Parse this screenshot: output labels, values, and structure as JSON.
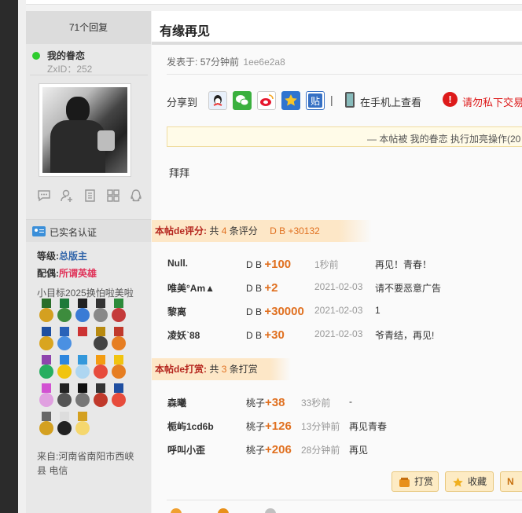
{
  "sidebar": {
    "reply_count": "71个回复",
    "username": "我的眷恋",
    "zxid": "ZxID：252",
    "realname": "已实名认证",
    "level_label": "等级:",
    "level_value": "总版主",
    "match_label": "配偶:",
    "match_value": "所谓英雄",
    "motto": "小目标2025换怕啦美啦",
    "from": "来自:河南省南阳市西峡县 电信",
    "icons": [
      "chat-icon",
      "add-user-icon",
      "document-icon",
      "grid-icon",
      "qq-icon"
    ]
  },
  "post": {
    "title": "有缘再见",
    "time_prefix": "发表于:",
    "time": "57分钟前",
    "hash": "1ee6e2a8",
    "share_label": "分享到",
    "share_icons": [
      "qq-icon",
      "wechat-icon",
      "weibo-icon",
      "qzone-icon",
      "tieba-icon"
    ],
    "pipe": "|",
    "mobile_view": "在手机上查看",
    "warning": "请勿私下交易",
    "notice": "— 本帖被 我的眷恋 执行加亮操作(20",
    "content": "拜拜"
  },
  "ratings": {
    "label": "本帖de评分:",
    "summary_prefix": "共",
    "count": "4",
    "summary_suffix": "条评分",
    "total": "D B  +30132",
    "rows": [
      {
        "name": "Null.",
        "unit": "D B ",
        "amount": "+100",
        "time": "1秒前",
        "reason": "再见！青春！"
      },
      {
        "name": "唯美°Am▲",
        "unit": "D B ",
        "amount": "+2",
        "time": "2021-02-03",
        "reason": "请不要恶意广告"
      },
      {
        "name": "黎离",
        "unit": "D B ",
        "amount": "+30000",
        "time": "2021-02-03",
        "reason": "1"
      },
      {
        "name": "凌妖ˋ88",
        "unit": "D B ",
        "amount": "+30",
        "time": "2021-02-03",
        "reason": "爷青结，再见!"
      }
    ]
  },
  "tips": {
    "label": "本帖de打赏:",
    "summary_prefix": "共",
    "count": "3",
    "summary_suffix": "条打赏",
    "rows": [
      {
        "name": "森曦",
        "unit": "桃子",
        "amount": "+38",
        "time": "33秒前",
        "reason": "-"
      },
      {
        "name": "栀屿1cd6b",
        "unit": "桃子",
        "amount": "+126",
        "time": "13分钟前",
        "reason": "再见青春"
      },
      {
        "name": "呼叫小歪",
        "unit": "桃子",
        "amount": "+206",
        "time": "28分钟前",
        "reason": "再见"
      }
    ]
  },
  "actions": {
    "tip": "打赏",
    "favorite": "收藏",
    "third": "N"
  },
  "colors": {
    "accent_orange": "#e07020",
    "label_red": "#b5261e",
    "warning_red": "#dd1a1a",
    "online_green": "#2ecc2e"
  }
}
